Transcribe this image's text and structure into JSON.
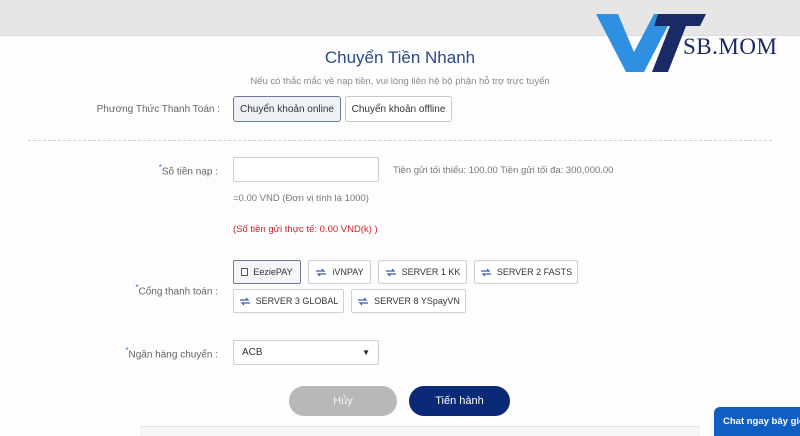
{
  "page": {
    "title": "Chuyển Tiền Nhanh",
    "note": "Nếu có thắc mắc về nạp tiền, vui lòng liên hệ bộ phận hỗ trợ trực tuyến"
  },
  "payment_method": {
    "label": "Phương Thức Thanh Toán  :",
    "options": [
      "Chuyển khoản online",
      "Chuyển khoản offline"
    ],
    "selected": "Chuyển khoản online"
  },
  "amount": {
    "label": "Số tiền nạp  :",
    "value": "",
    "limits": "Tiền gửi tối thiểu: 100.00 Tiền gửi tối đa: 300,000.00",
    "converted": "=0.00 VND (Đơn vị tính là 1000)",
    "actual": "(Số tiền gửi thực tế: 0.00 VND(k) )"
  },
  "gateway": {
    "label": "Cổng thanh toán  :",
    "options": [
      "EeziePAY",
      "iVNPAY",
      "SERVER 1 KK",
      "SERVER 2 FASTS",
      "SERVER 3 GLOBAL",
      "SERVER 8 YSpayVN"
    ],
    "selected": "EeziePAY"
  },
  "bank": {
    "label": "Ngân hàng chuyển  :",
    "selected": "ACB"
  },
  "actions": {
    "cancel": "Hủy",
    "submit": "Tiến hành"
  },
  "brand": {
    "logo_text": "SB.MOM",
    "logo_color": "#1a2a66",
    "logo_accent": "#2f8fe0"
  },
  "chat": {
    "label": "Chat ngay bây giờ"
  },
  "colors": {
    "title": "#2b4a86",
    "primary_button": "#0a2a78",
    "warning_text": "#c8232c",
    "chat": "#0f5ec2"
  }
}
